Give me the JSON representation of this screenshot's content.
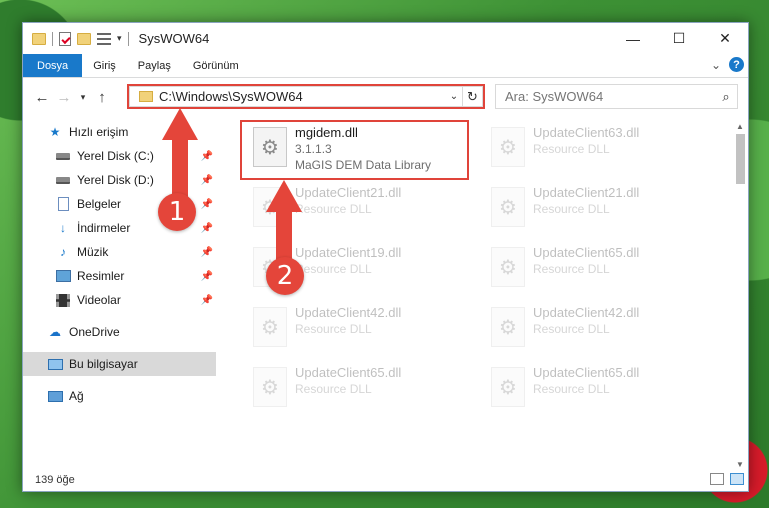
{
  "window": {
    "title": "SysWOW64",
    "controls": {
      "minimize": "—",
      "maximize": "☐",
      "close": "✕"
    }
  },
  "ribbon": {
    "tabs": [
      "Dosya",
      "Giriş",
      "Paylaş",
      "Görünüm"
    ]
  },
  "navigation": {
    "address_path": "C:\\Windows\\SysWOW64",
    "search_placeholder": "Ara: SysWOW64"
  },
  "sidebar": {
    "quick_access": "Hızlı erişim",
    "items": [
      {
        "label": "Yerel Disk (C:)",
        "icon": "drive-icon"
      },
      {
        "label": "Yerel Disk (D:)",
        "icon": "drive-icon"
      },
      {
        "label": "Belgeler",
        "icon": "documents-icon"
      },
      {
        "label": "İndirmeler",
        "icon": "downloads-icon"
      },
      {
        "label": "Müzik",
        "icon": "music-icon"
      },
      {
        "label": "Resimler",
        "icon": "pictures-icon"
      },
      {
        "label": "Videolar",
        "icon": "videos-icon"
      }
    ],
    "onedrive": "OneDrive",
    "this_pc": "Bu bilgisayar",
    "network": "Ağ"
  },
  "files": {
    "selected": {
      "name": "mgidem.dll",
      "version": "3.1.1.3",
      "description": "MaGIS DEM Data Library"
    },
    "ghost": [
      {
        "name": "UpdateClient63.dll",
        "desc": "Resource DLL"
      },
      {
        "name": "UpdateClient21.dll",
        "desc": "Resource DLL"
      },
      {
        "name": "UpdateClient21.dll",
        "desc": "Resource DLL"
      },
      {
        "name": "UpdateClient19.dll",
        "desc": "Resource DLL"
      },
      {
        "name": "UpdateClient65.dll",
        "desc": "Resource DLL"
      },
      {
        "name": "UpdateClient42.dll",
        "desc": "Resource DLL"
      },
      {
        "name": "UpdateClient42.dll",
        "desc": "Resource DLL"
      },
      {
        "name": "UpdateClient65.dll",
        "desc": "Resource DLL"
      },
      {
        "name": "UpdateClient65.dll",
        "desc": "Resource DLL"
      }
    ]
  },
  "status": {
    "item_count": "139 öğe"
  },
  "annotations": {
    "step1": "1",
    "step2": "2",
    "color": "#e4453a"
  }
}
